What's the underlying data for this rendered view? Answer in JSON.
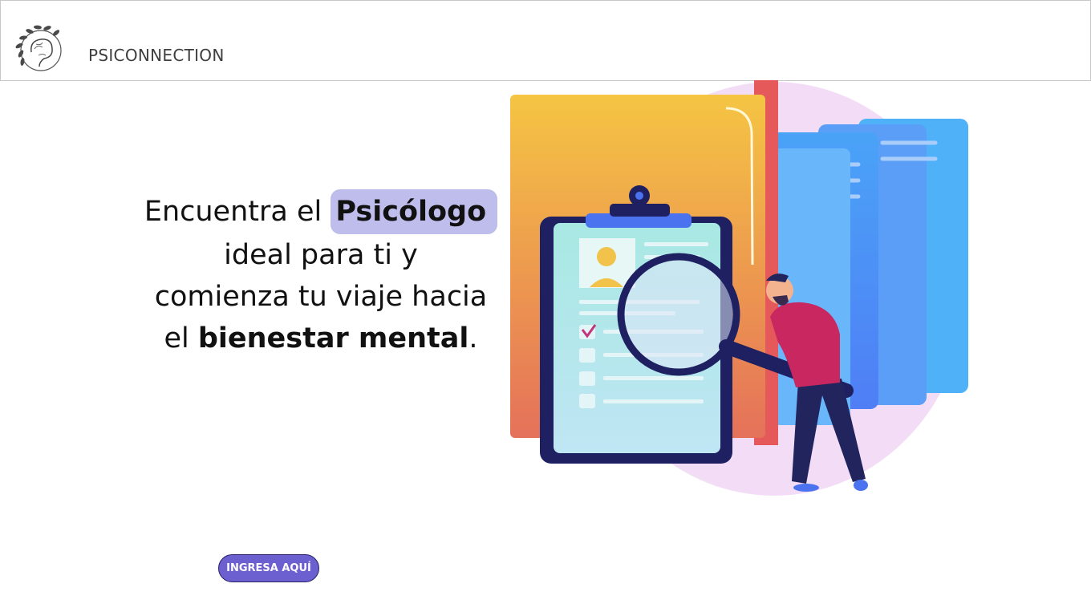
{
  "header": {
    "brand": "PSICONNECTION",
    "logo_icon": "brain-laurel-icon"
  },
  "hero": {
    "l1_prefix": "Encuentra el ",
    "l1_highlight": "Psicólogo",
    "l2": "ideal para ti y",
    "l3": "comienza tu viaje hacia",
    "l4_prefix": "el ",
    "l4_bold": "bienestar mental",
    "l4_suffix": "."
  },
  "cta": {
    "label": "INGRESA AQUÍ"
  },
  "illustration": {
    "icon": "clipboard-search-illustration"
  },
  "colors": {
    "accent": "#6c5fd0",
    "highlight": "#bfbdec",
    "text": "#111111"
  }
}
